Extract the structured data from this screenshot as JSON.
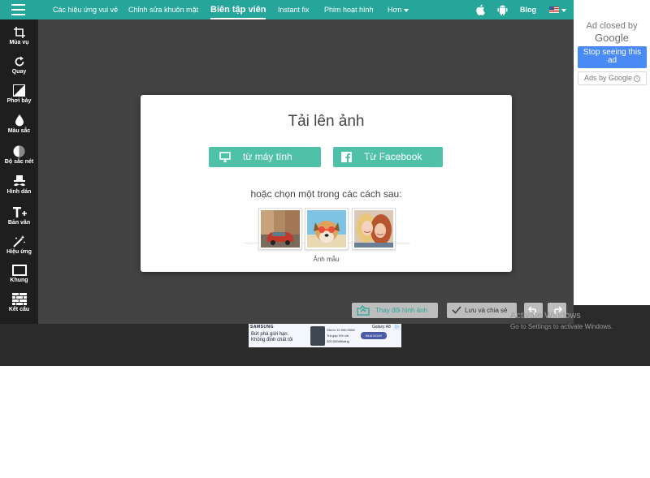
{
  "topbar": {
    "nav_items": [
      "Các hiệu ứng vui vẻ",
      "Chỉnh sửa khuôn mặt",
      "Biên tập viên",
      "Instant fix",
      "Phim hoạt hình",
      "Hơn"
    ],
    "blog": "Blog",
    "icons": [
      "menu-icon",
      "apple-icon",
      "android-icon",
      "flag-icon"
    ]
  },
  "sidebar": {
    "tools": [
      {
        "label": "Mùa vụ",
        "icon": "crop-icon"
      },
      {
        "label": "Quay",
        "icon": "rotate-icon"
      },
      {
        "label": "Phơi bày",
        "icon": "exposure-icon"
      },
      {
        "label": "Màu sắc",
        "icon": "drop-icon"
      },
      {
        "label": "Độ sắc nét",
        "icon": "contrast-icon"
      },
      {
        "label": "Hình dán",
        "icon": "mustache-hat-icon"
      },
      {
        "label": "Bản văn",
        "icon": "text-icon"
      },
      {
        "label": "Hiệu ứng",
        "icon": "magic-wand-icon"
      },
      {
        "label": "Khung",
        "icon": "frame-icon"
      },
      {
        "label": "Kết cấu",
        "icon": "texture-icon"
      }
    ]
  },
  "dialog": {
    "title": "Tải lên ảnh",
    "from_computer": "từ máy tính",
    "from_facebook": "Từ Facebook",
    "choose_text": "hoặc chọn một trong các cách sau:",
    "samples_label": "Ảnh mẫu"
  },
  "actions": {
    "change_image": "Thay đổi hình ảnh",
    "save_share": "Lưu và chia sẻ"
  },
  "watermark": {
    "line1": "Activate Windows",
    "line2": "Go to Settings to activate Windows."
  },
  "ad_banner": {
    "brand": "SAMSUNG",
    "headline1": "Bứt phá giới hạn.",
    "headline2": "Không định chất tôi",
    "product": "Galaxy A8",
    "info1": "Giá từ 10.990.000đ",
    "info2": "Trả góp 0% với",
    "info3": "300.000đ/tháng",
    "cta": "MUA NGAY",
    "choices": "▷"
  },
  "google_ad": {
    "closed_by": "Ad closed by",
    "logo": "Google",
    "stop_seeing": "Stop seeing this ad",
    "ads_by": "Ads by Google",
    "info": "i"
  },
  "colors": {
    "accent": "#26a69a",
    "button_green": "#4fc1a9",
    "sidebar_bg": "#1e1e1e",
    "canvas_bg": "#434343",
    "google_blue": "#4a8af4"
  }
}
